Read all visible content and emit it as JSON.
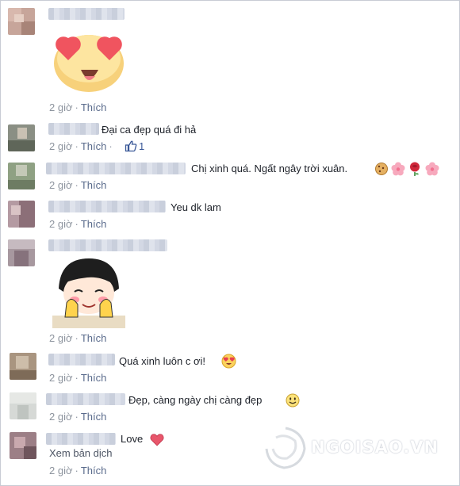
{
  "comments": [
    {
      "text": "",
      "time": "2 giờ",
      "like": "Thích"
    },
    {
      "text": "Đại ca đẹp quá đi hả",
      "time": "2 giờ",
      "like": "Thích",
      "likes": "1"
    },
    {
      "text": "Chị xinh quá. Ngất ngây trời xuân.",
      "time": "2 giờ",
      "like": "Thích"
    },
    {
      "text": "Yeu dk lam",
      "time": "2 giờ",
      "like": "Thích"
    },
    {
      "text": "",
      "time": "2 giờ",
      "like": "Thích"
    },
    {
      "text": "Quá xinh luôn c ơi!",
      "time": "2 giờ",
      "like": "Thích"
    },
    {
      "text": "Đẹp, càng ngày chị càng đẹp",
      "time": "2 giờ",
      "like": "Thích"
    },
    {
      "text": "Love",
      "time": "2 giờ",
      "like": "Thích",
      "translate": "Xem bản dịch"
    }
  ],
  "watermark": "NGOISAO.VN",
  "icons": {
    "heart_eyes": "heart-eyes-sticker",
    "girl_sticker": "girl-sticker",
    "thumbs_up": "thumbs-up-icon",
    "cookie": "cookie-emoji",
    "flower": "cherry-blossom-emoji",
    "rose": "rose-emoji",
    "heart_eyes_small": "heart-eyes-emoji",
    "smile": "smile-emoji",
    "heart": "heart-emoji"
  },
  "colors": {
    "link": "#3b5998",
    "meta": "#8d949e",
    "heart": "#e8566b"
  }
}
